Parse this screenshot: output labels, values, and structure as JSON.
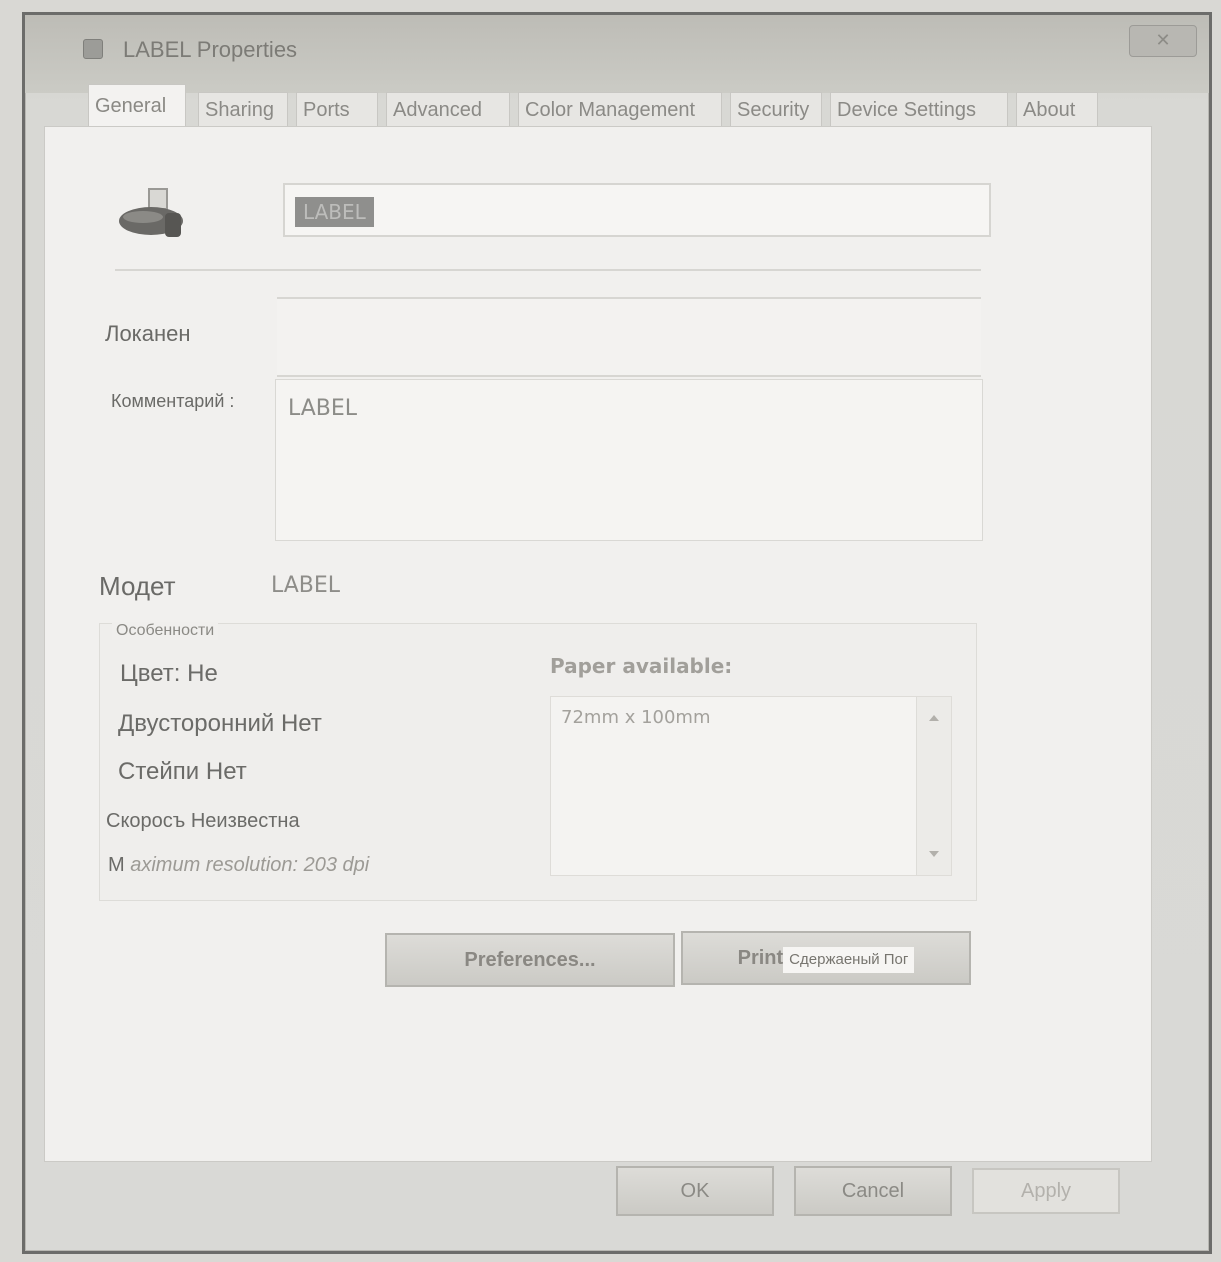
{
  "window": {
    "title": "LABEL Properties",
    "close_label": "✕"
  },
  "tabs": [
    {
      "label": "General",
      "active": true
    },
    {
      "label": "Sharing",
      "active": false
    },
    {
      "label": "Ports",
      "active": false
    },
    {
      "label": "Advanced",
      "active": false
    },
    {
      "label": "Color Management",
      "active": false
    },
    {
      "label": "Security",
      "active": false
    },
    {
      "label": "Device Settings",
      "active": false
    },
    {
      "label": "About",
      "active": false
    }
  ],
  "general": {
    "printer_name": "LABEL",
    "location_label": "Локанен",
    "location_value": "",
    "comment_label": "Комментарий :",
    "comment_value": "LABEL",
    "model_label": "Модет",
    "model_value": "LABEL",
    "features": {
      "legend": "Особенности",
      "color": "Цвет: Не",
      "duplex": "Двусторонний Нет",
      "staple": "Стейпи Нет",
      "speed": "Скоросъ Неизвестна",
      "max_resolution_prefix": "М",
      "max_resolution": "aximum resolution: 203 dpi",
      "paper_available_label": "Paper available:",
      "paper_items": [
        "72mm x 100mm"
      ]
    },
    "preferences_button": "Preferences...",
    "test_print_button": "Print",
    "test_print_overlay": "Сдержаеный Пог"
  },
  "footer": {
    "ok": "OK",
    "cancel": "Cancel",
    "apply": "Apply"
  },
  "colors": {
    "dialog_bg": "#efeeec",
    "selection": "#8f8f8d"
  }
}
